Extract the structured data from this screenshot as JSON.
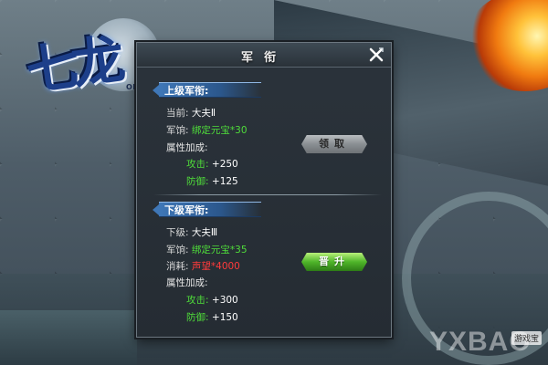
{
  "dialog": {
    "title": "军衔"
  },
  "upper": {
    "header": "上级军衔:",
    "current_label": "当前:",
    "current_value": "大夫Ⅱ",
    "salary_label": "军饷:",
    "salary_value": "绑定元宝*30",
    "attr_label": "属性加成:",
    "attack_label": "攻击:",
    "attack_value": "+250",
    "defense_label": "防御:",
    "defense_value": "+125",
    "button_label": "领取"
  },
  "lower": {
    "header": "下级军衔:",
    "next_label": "下级:",
    "next_value": "大夫Ⅲ",
    "salary_label": "军饷:",
    "salary_value": "绑定元宝*35",
    "cost_label": "消耗:",
    "cost_value": "声望*4000",
    "attr_label": "属性加成:",
    "attack_label": "攻击:",
    "attack_value": "+300",
    "defense_label": "防御:",
    "defense_value": "+150",
    "button_label": "晋升"
  },
  "logo": {
    "text": "七龙",
    "sub": "ONLINE"
  },
  "watermark": {
    "text": "YXBAO",
    "tag": "游戏宝"
  },
  "colors": {
    "panel_bg": "#252c33",
    "header_blue": "#3f77b7",
    "value_green": "#4fdc3a",
    "value_red": "#ff3b3b",
    "button_gray": "#8a8f93",
    "button_green": "#4fb52a"
  },
  "icons": {
    "close": "close-x-icon"
  }
}
